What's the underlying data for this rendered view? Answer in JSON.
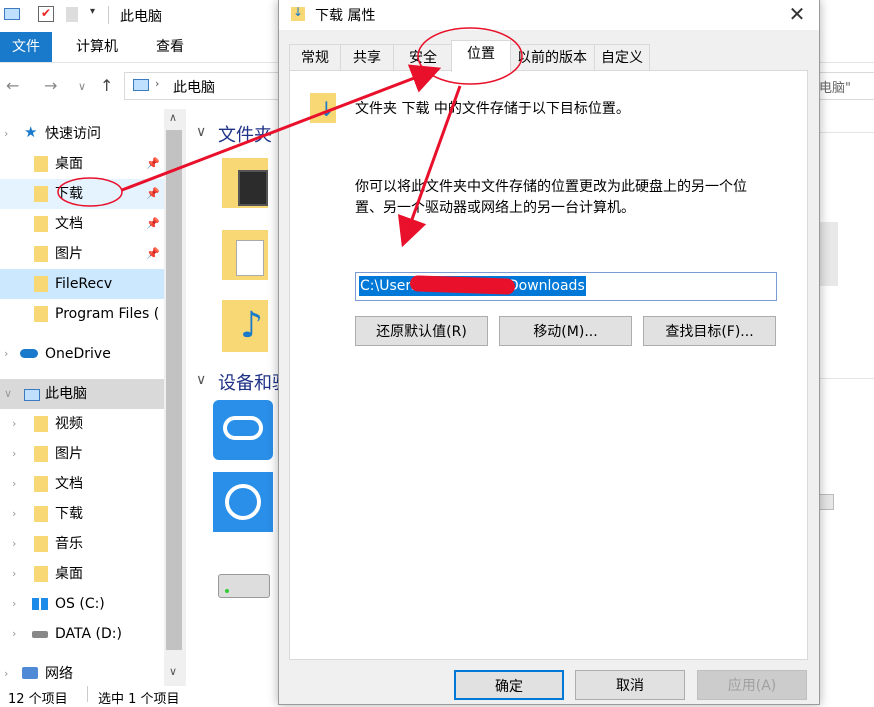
{
  "explorer": {
    "window_title": "此电脑",
    "ribbon_tabs": [
      "文件",
      "计算机",
      "查看"
    ],
    "address_path": "此电脑",
    "search_placeholder": "电脑\"",
    "nav": {
      "quick_access": "快速访问",
      "qa_items": [
        "桌面",
        "下载",
        "文档",
        "图片",
        "FileRecv",
        "Program Files ("
      ],
      "onedrive": "OneDrive",
      "this_pc": "此电脑",
      "pc_items": [
        "视频",
        "图片",
        "文档",
        "下载",
        "音乐",
        "桌面",
        "OS (C:)",
        "DATA (D:)"
      ],
      "network": "网络"
    },
    "sections": {
      "folders": "文件夹",
      "devices": "设备和驱"
    },
    "status": {
      "count": "12 个项目",
      "selected": "选中 1 个项目"
    }
  },
  "dialog": {
    "title": "下载 属性",
    "tabs": [
      "常规",
      "共享",
      "安全",
      "位置",
      "以前的版本",
      "自定义"
    ],
    "active_tab": "位置",
    "description": "文件夹 下载 中的文件存储于以下目标位置。",
    "explain_line1": "你可以将此文件夹中文件存储的位置更改为此硬盘上的另一个位",
    "explain_line2": "置、另一个驱动器或网络上的另一台计算机。",
    "path_prefix": "C:\\Users\\",
    "path_suffix": "\\Downloads",
    "buttons": {
      "restore": "还原默认值(R)",
      "move": "移动(M)...",
      "find": "查找目标(F)..."
    },
    "footer": {
      "ok": "确定",
      "cancel": "取消",
      "apply": "应用(A)"
    }
  },
  "colors": {
    "accent": "#0078d7",
    "file_tab": "#1979ca",
    "annotation": "#e8102a",
    "folder": "#f8d775"
  }
}
